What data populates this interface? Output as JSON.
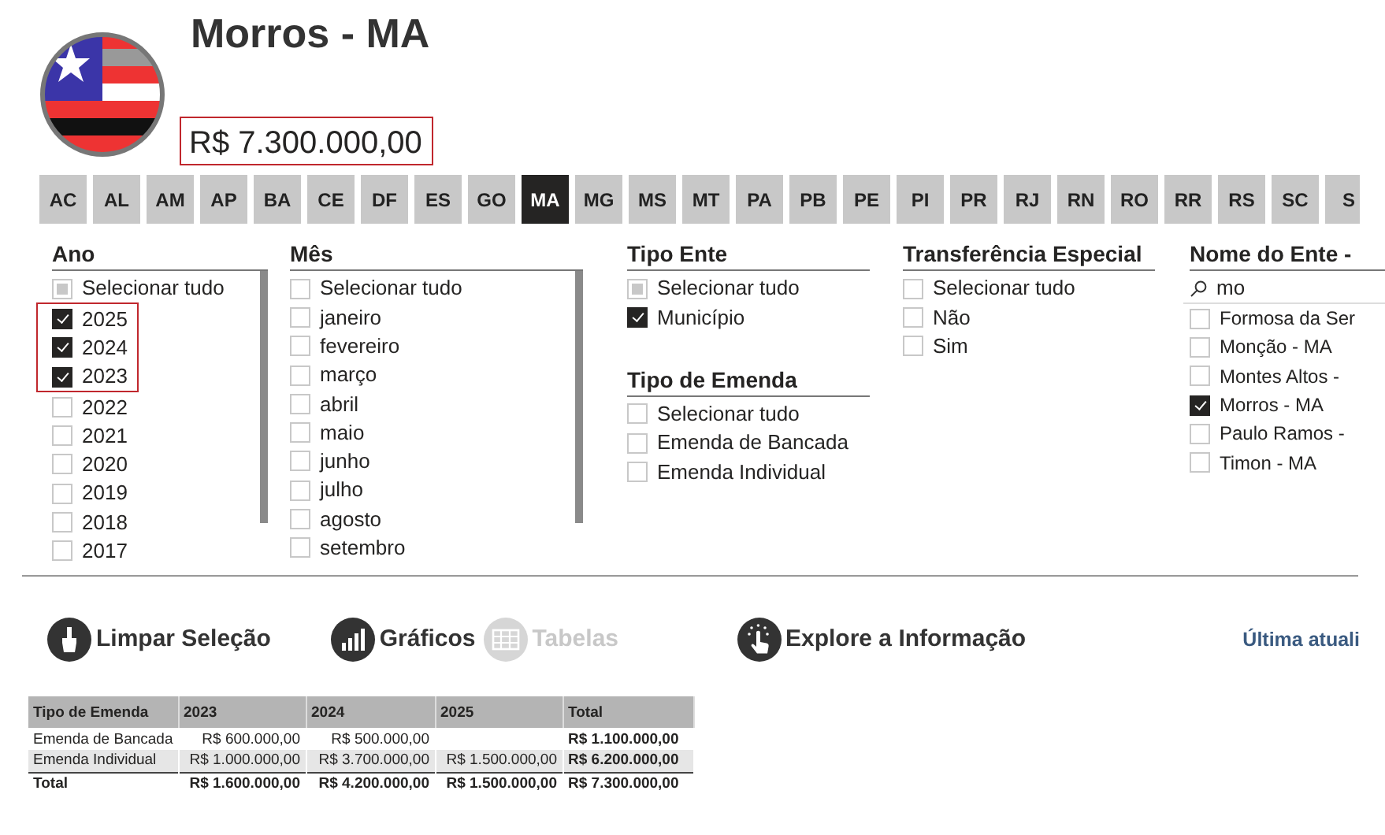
{
  "header": {
    "title": "Morros - MA",
    "total": "R$ 7.300.000,00",
    "total_highlighted": true
  },
  "states": [
    {
      "label": "AC",
      "selected": false
    },
    {
      "label": "AL",
      "selected": false
    },
    {
      "label": "AM",
      "selected": false
    },
    {
      "label": "AP",
      "selected": false
    },
    {
      "label": "BA",
      "selected": false
    },
    {
      "label": "CE",
      "selected": false
    },
    {
      "label": "DF",
      "selected": false
    },
    {
      "label": "ES",
      "selected": false
    },
    {
      "label": "GO",
      "selected": false
    },
    {
      "label": "MA",
      "selected": true
    },
    {
      "label": "MG",
      "selected": false
    },
    {
      "label": "MS",
      "selected": false
    },
    {
      "label": "MT",
      "selected": false
    },
    {
      "label": "PA",
      "selected": false
    },
    {
      "label": "PB",
      "selected": false
    },
    {
      "label": "PE",
      "selected": false
    },
    {
      "label": "PI",
      "selected": false
    },
    {
      "label": "PR",
      "selected": false
    },
    {
      "label": "RJ",
      "selected": false
    },
    {
      "label": "RN",
      "selected": false
    },
    {
      "label": "RO",
      "selected": false
    },
    {
      "label": "RR",
      "selected": false
    },
    {
      "label": "RS",
      "selected": false
    },
    {
      "label": "SC",
      "selected": false
    },
    {
      "label": "S",
      "selected": false
    }
  ],
  "slicer_columns": [
    {
      "slicers": [
        {
          "title": "Ano",
          "kind": "scroll",
          "items": [
            {
              "label": "Selecionar tudo",
              "checked": false,
              "partial": true,
              "highlighted": false
            },
            {
              "label": "2025",
              "checked": true,
              "partial": false,
              "highlighted": true
            },
            {
              "label": "2024",
              "checked": true,
              "partial": false,
              "highlighted": true
            },
            {
              "label": "2023",
              "checked": true,
              "partial": false,
              "highlighted": true
            },
            {
              "label": "2022",
              "checked": false,
              "partial": false,
              "highlighted": false
            },
            {
              "label": "2021",
              "checked": false,
              "partial": false,
              "highlighted": false
            },
            {
              "label": "2020",
              "checked": false,
              "partial": false,
              "highlighted": false
            },
            {
              "label": "2019",
              "checked": false,
              "partial": false,
              "highlighted": false
            },
            {
              "label": "2018",
              "checked": false,
              "partial": false,
              "highlighted": false
            },
            {
              "label": "2017",
              "checked": false,
              "partial": false,
              "highlighted": false
            }
          ]
        }
      ]
    },
    {
      "slicers": [
        {
          "title": "Mês",
          "kind": "scroll",
          "items": [
            {
              "label": "Selecionar tudo",
              "checked": false,
              "partial": false
            },
            {
              "label": "janeiro",
              "checked": false,
              "partial": false
            },
            {
              "label": "fevereiro",
              "checked": false,
              "partial": false
            },
            {
              "label": "março",
              "checked": false,
              "partial": false
            },
            {
              "label": "abril",
              "checked": false,
              "partial": false
            },
            {
              "label": "maio",
              "checked": false,
              "partial": false
            },
            {
              "label": "junho",
              "checked": false,
              "partial": false
            },
            {
              "label": "julho",
              "checked": false,
              "partial": false
            },
            {
              "label": "agosto",
              "checked": false,
              "partial": false
            },
            {
              "label": "setembro",
              "checked": false,
              "partial": false
            }
          ]
        }
      ]
    },
    {
      "slicers": [
        {
          "title": "Tipo Ente",
          "kind": "list",
          "items": [
            {
              "label": "Selecionar tudo",
              "checked": false,
              "partial": true
            },
            {
              "label": "Município",
              "checked": true,
              "partial": false
            }
          ]
        },
        {
          "title": "Tipo de Emenda",
          "kind": "list",
          "items": [
            {
              "label": "Selecionar tudo",
              "checked": false,
              "partial": false
            },
            {
              "label": "Emenda de Bancada",
              "checked": false,
              "partial": false
            },
            {
              "label": "Emenda Individual",
              "checked": false,
              "partial": false
            }
          ]
        }
      ]
    },
    {
      "slicers": [
        {
          "title": "Transferência Especial",
          "kind": "list",
          "items": [
            {
              "label": "Selecionar tudo",
              "checked": false,
              "partial": false
            },
            {
              "label": "Não",
              "checked": false,
              "partial": false
            },
            {
              "label": "Sim",
              "checked": false,
              "partial": false
            }
          ]
        }
      ]
    },
    {
      "slicers": [
        {
          "title": "Nome do Ente -",
          "kind": "search",
          "search": "mo",
          "items": [
            {
              "label": "Formosa da Ser",
              "checked": false,
              "partial": false
            },
            {
              "label": "Monção - MA",
              "checked": false,
              "partial": false
            },
            {
              "label": "Montes Altos -",
              "checked": false,
              "partial": false
            },
            {
              "label": "Morros - MA",
              "checked": true,
              "partial": false
            },
            {
              "label": "Paulo Ramos -",
              "checked": false,
              "partial": false
            },
            {
              "label": "Timon - MA",
              "checked": false,
              "partial": false
            }
          ]
        }
      ]
    }
  ],
  "actions": [
    {
      "label": "Limpar Seleção",
      "kind": "brush",
      "disabled": false
    },
    {
      "label": "Gráficos",
      "kind": "chart",
      "disabled": false
    },
    {
      "label": "Tabelas",
      "kind": "table",
      "disabled": true
    },
    {
      "label": "Explore a Informação",
      "kind": "touch",
      "disabled": false
    }
  ],
  "last_update": "Última atuali",
  "table": {
    "columns": [
      "Tipo de Emenda",
      "2023",
      "2024",
      "2025",
      "Total"
    ],
    "rows": [
      {
        "kind": "data",
        "cells": [
          "Emenda de Bancada",
          "R$ 600.000,00",
          "R$ 500.000,00",
          "",
          "R$ 1.100.000,00"
        ]
      },
      {
        "kind": "data",
        "cells": [
          "Emenda Individual",
          "R$ 1.000.000,00",
          "R$ 3.700.000,00",
          "R$ 1.500.000,00",
          "R$ 6.200.000,00"
        ]
      },
      {
        "kind": "total",
        "cells": [
          "Total",
          "R$ 1.600.000,00",
          "R$ 4.200.000,00",
          "R$ 1.500.000,00",
          "R$ 7.300.000,00"
        ]
      }
    ]
  }
}
